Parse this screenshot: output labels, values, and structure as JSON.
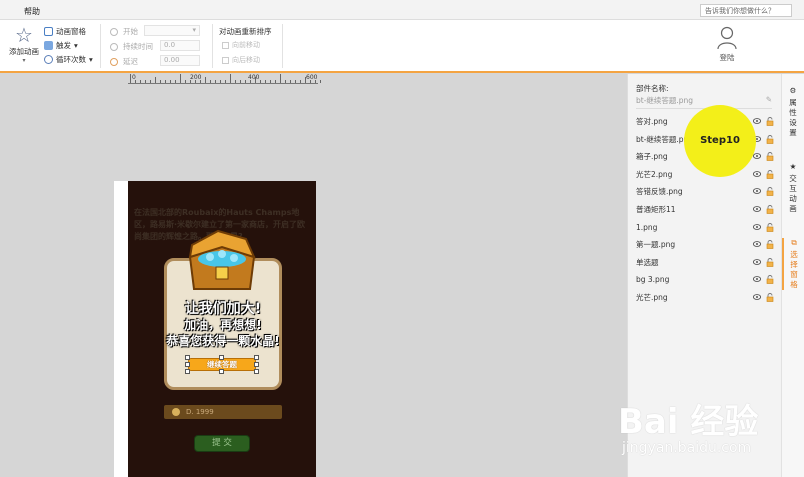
{
  "menu": {
    "help": "帮助",
    "tell_me_placeholder": "告诉我们你想做什么？"
  },
  "ribbon": {
    "add_animation": "添加动画",
    "animation_pane": "动画窗格",
    "trigger": "触发",
    "loop_count": "循环次数",
    "timing": {
      "start_label": "开始",
      "duration_label": "持续时间",
      "delay_label": "延迟",
      "duration_value": "0.0",
      "delay_value": "0.00"
    },
    "reorder": {
      "title": "对动画重新排序",
      "move_earlier": "向前移动",
      "move_later": "向后移动"
    },
    "login": "登陆"
  },
  "ruler": {
    "ticks": [
      "0",
      "200",
      "400",
      "600"
    ]
  },
  "canvas": {
    "story_text": "在法国北部的Roubaix的Hauts Champs地区，路易斯·米歇尔建立了第一家商店，开启了欧尚集团的辉煌之路。那一年是?",
    "popup_lines": [
      "让我们加大!",
      "加油，再想想!",
      "恭喜您获得一颗水晶!"
    ],
    "continue_button": "继续答题",
    "option_d": "D. 1999",
    "submit_button": "提 交"
  },
  "panel": {
    "title": "部件名称:",
    "selected_name": "bt-继续答题.png",
    "layers": [
      "答对.png",
      "bt-继续答题.png",
      "箱子.png",
      "光芒2.png",
      "答错反馈.png",
      "普通矩形11",
      "1.png",
      "第一题.png",
      "单选题",
      "bg 3.png",
      "光芒.png"
    ]
  },
  "sidebar": {
    "tabs": [
      {
        "label": "属性设置"
      },
      {
        "label": "交互动画"
      },
      {
        "label": "选择窗格"
      }
    ]
  },
  "step_badge": "Step10",
  "watermark": {
    "logo": "Bai 经验",
    "url": "jingyan.baidu.com"
  },
  "colors": {
    "accent": "#f4a442",
    "step": "#f3ef19",
    "selected_tab": "#e57b18"
  }
}
